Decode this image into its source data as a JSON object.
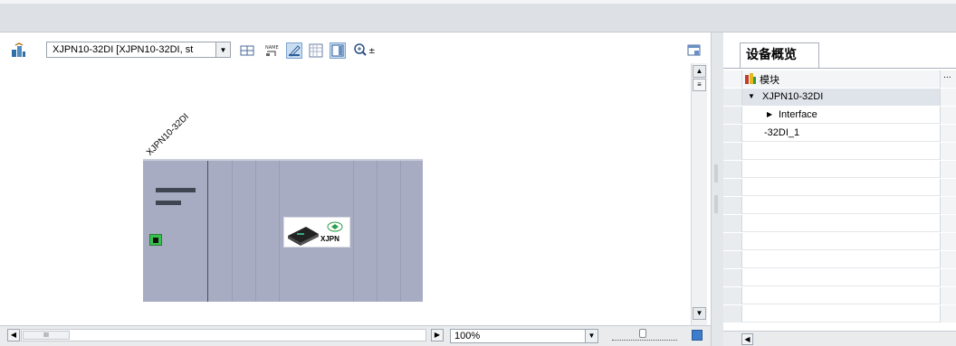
{
  "device_view": {
    "device_select_value": "XJPN10-32DI [XJPN10-32DI, st",
    "canvas_device_label": "XJPN10-32DI",
    "module_label": "XJPN",
    "zoom_value": "100%",
    "hscroll_thumb": "III"
  },
  "device_overview": {
    "tab_label": "设备概览",
    "header_label": "模块",
    "header_extra": "...",
    "rows": [
      {
        "label": "XJPN10-32DI",
        "expander": "▼"
      },
      {
        "label": "Interface",
        "expander": "▶"
      },
      {
        "label": "-32DI_1",
        "expander": ""
      }
    ]
  },
  "icons": {
    "toolbar": [
      "topology-icon",
      "network-view-icon",
      "name-icon",
      "edit-icon",
      "grid-icon",
      "pane-icon",
      "zoom-icon"
    ],
    "accent_green": "#36c14a",
    "rack_color": "#a7acc3"
  }
}
